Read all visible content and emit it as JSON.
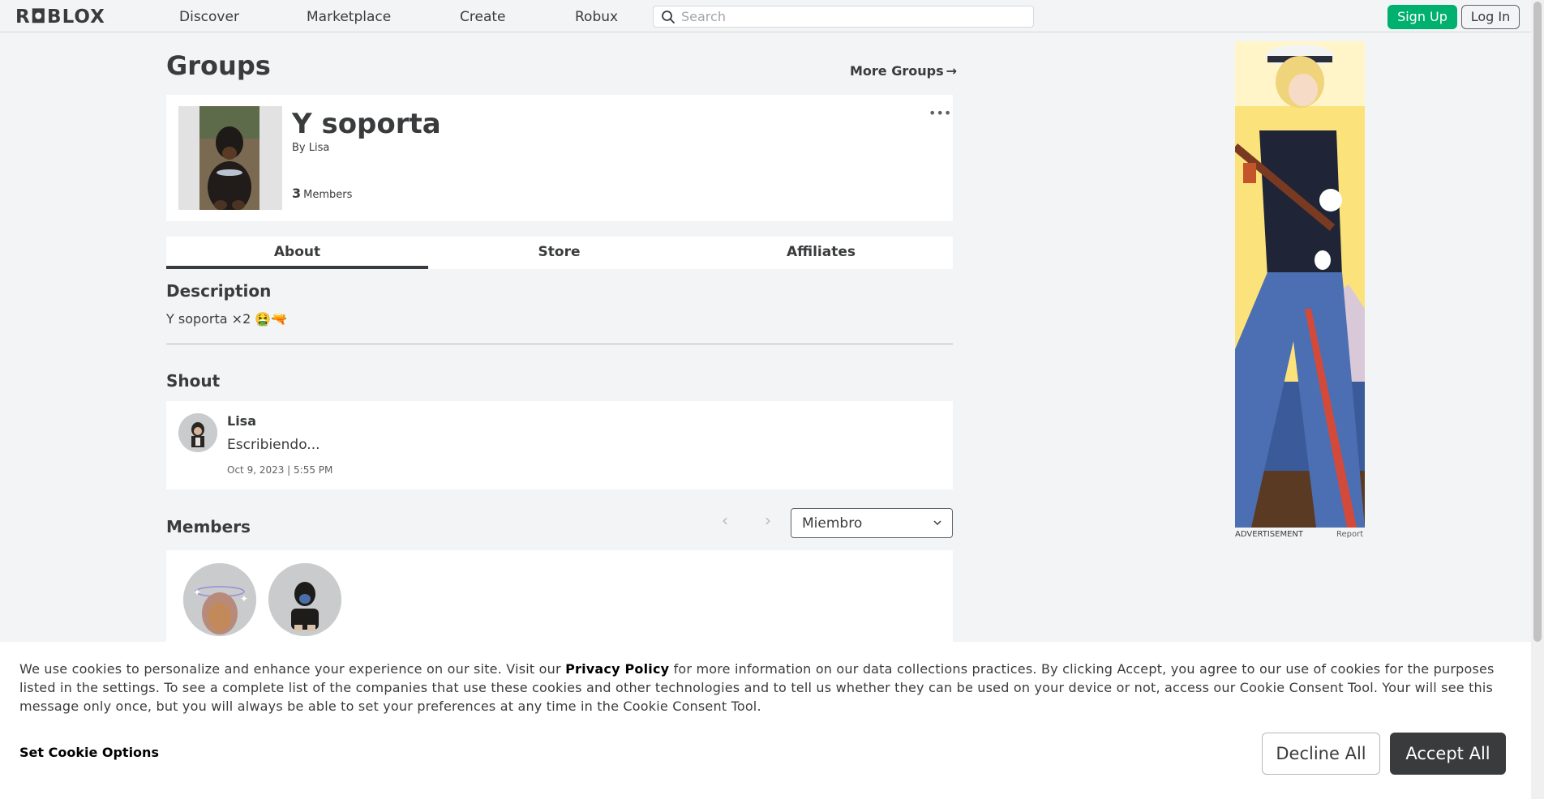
{
  "nav": {
    "logo": "R◘BLOX",
    "links": [
      "Discover",
      "Marketplace",
      "Create",
      "Robux"
    ],
    "search_placeholder": "Search",
    "sign_up": "Sign Up",
    "log_in": "Log In"
  },
  "page": {
    "title": "Groups",
    "more_groups": "More Groups",
    "more_groups_arrow": "→"
  },
  "group": {
    "name": "Y soporta",
    "by_label": "By",
    "owner": "Lisa",
    "member_count": "3",
    "member_label": "Members",
    "more_icon": "•••"
  },
  "tabs": [
    "About",
    "Store",
    "Affiliates"
  ],
  "description": {
    "heading": "Description",
    "text": "Y soporta ×2 🤮🔫"
  },
  "shout": {
    "heading": "Shout",
    "author": "Lisa",
    "body": "Escribiendo...",
    "date": "Oct 9, 2023 | 5:55 PM"
  },
  "members": {
    "heading": "Members",
    "prev_icon": "‹",
    "next_icon": "›",
    "role_selected": "Miembro"
  },
  "ad": {
    "label": "ADVERTISEMENT",
    "report": "Report"
  },
  "cookie": {
    "text_before": "We use cookies to personalize and enhance your experience on our site. Visit our ",
    "privacy_link": "Privacy Policy",
    "text_after": " for more information on our data collections practices. By clicking Accept, you agree to our use of cookies for the purposes listed in the settings. To see a complete list of the companies that use these cookies and other technologies and to tell us whether they can be used on your device or not, access our Cookie Consent Tool. Your will see this message only once, but you will always be able to set your preferences at any time in the Cookie Consent Tool.",
    "set_options": "Set Cookie Options",
    "decline": "Decline All",
    "accept": "Accept All"
  },
  "colors": {
    "page_bg": "#f2f4f5",
    "text": "#393b3d",
    "signup_green": "#00b06f",
    "accept_bg": "#393b3d"
  }
}
